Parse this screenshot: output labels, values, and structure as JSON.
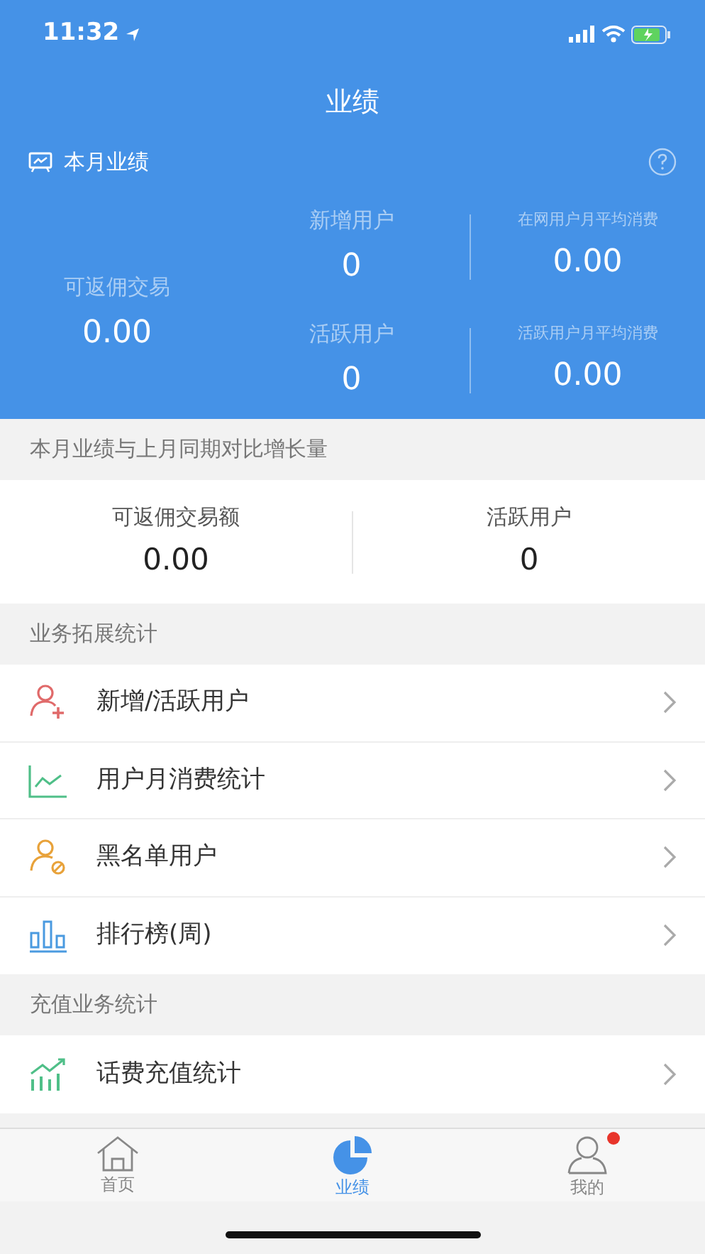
{
  "status_bar": {
    "time": "11:32"
  },
  "header": {
    "title": "业绩",
    "section_label": "本月业绩",
    "main_stat": {
      "label": "可返佣交易",
      "value": "0.00"
    },
    "stats": [
      {
        "label": "新增用户",
        "value": "0"
      },
      {
        "label": "在网用户月平均消费",
        "value": "0.00"
      },
      {
        "label": "活跃用户",
        "value": "0"
      },
      {
        "label": "活跃用户月平均消费",
        "value": "0.00"
      }
    ]
  },
  "comparison": {
    "heading": "本月业绩与上月同期对比增长量",
    "stats": [
      {
        "label": "可返佣交易额",
        "value": "0.00"
      },
      {
        "label": "活跃用户",
        "value": "0"
      }
    ]
  },
  "sections": [
    {
      "heading": "业务拓展统计",
      "items": [
        {
          "label": "新增/活跃用户",
          "kind": "user-add"
        },
        {
          "label": "用户月消费统计",
          "kind": "line-chart"
        },
        {
          "label": "黑名单用户",
          "kind": "user-block"
        },
        {
          "label": "排行榜(周)",
          "kind": "bar-chart"
        }
      ]
    },
    {
      "heading": "充值业务统计",
      "items": [
        {
          "label": "话费充值统计",
          "kind": "growth-chart"
        }
      ]
    }
  ],
  "tabs": [
    {
      "label": "首页",
      "kind": "home",
      "selected": false,
      "badge": false
    },
    {
      "label": "业绩",
      "kind": "pie",
      "selected": true,
      "badge": false
    },
    {
      "label": "我的",
      "kind": "person",
      "selected": false,
      "badge": true
    }
  ]
}
